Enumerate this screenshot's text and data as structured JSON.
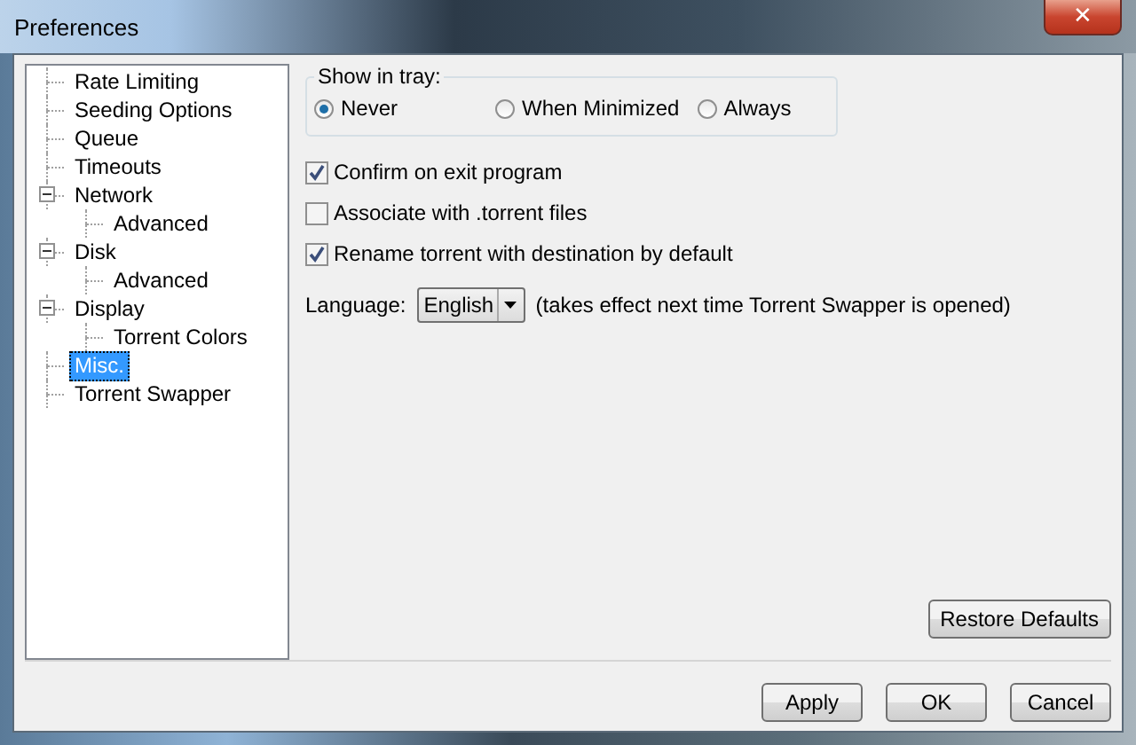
{
  "window": {
    "title": "Preferences",
    "close_label": "✕"
  },
  "tree": {
    "items": [
      {
        "label": "Rate Limiting",
        "selected": false
      },
      {
        "label": "Seeding Options",
        "selected": false
      },
      {
        "label": "Queue",
        "selected": false
      },
      {
        "label": "Timeouts",
        "selected": false
      },
      {
        "label": "Network",
        "selected": false,
        "expanded": true,
        "children": [
          {
            "label": "Advanced",
            "selected": false
          }
        ]
      },
      {
        "label": "Disk",
        "selected": false,
        "expanded": true,
        "children": [
          {
            "label": "Advanced",
            "selected": false
          }
        ]
      },
      {
        "label": "Display",
        "selected": false,
        "expanded": true,
        "children": [
          {
            "label": "Torrent Colors",
            "selected": false
          }
        ]
      },
      {
        "label": "Misc.",
        "selected": true
      },
      {
        "label": "Torrent Swapper",
        "selected": false
      }
    ]
  },
  "tray": {
    "legend": "Show in tray:",
    "options": [
      {
        "label": "Never",
        "selected": true
      },
      {
        "label": "When Minimized",
        "selected": false
      },
      {
        "label": "Always",
        "selected": false
      }
    ]
  },
  "checkboxes": [
    {
      "label": "Confirm on exit program",
      "checked": true
    },
    {
      "label": "Associate with .torrent files",
      "checked": false
    },
    {
      "label": "Rename torrent with destination by default",
      "checked": true
    }
  ],
  "language": {
    "label": "Language:",
    "value": "English",
    "note": "(takes effect next time Torrent Swapper is opened)"
  },
  "restore_button": "Restore Defaults",
  "buttons": [
    "Apply",
    "OK",
    "Cancel"
  ]
}
